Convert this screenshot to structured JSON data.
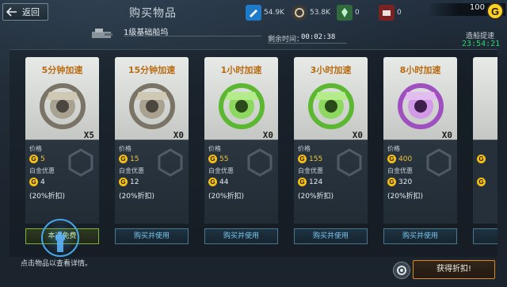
{
  "header": {
    "back_label": "返回",
    "title": "购买物品",
    "resources": [
      {
        "icon": "blueprint-icon",
        "value": "54.9K"
      },
      {
        "icon": "helmet-icon",
        "value": "53.8K"
      },
      {
        "icon": "crystal-icon",
        "value": "0"
      },
      {
        "icon": "cargo-icon",
        "value": "0"
      }
    ],
    "g_balance": "100",
    "g_logo": "G"
  },
  "info": {
    "dock_name": "1级基础船坞",
    "remaining_label": "剩余时间：",
    "remaining_time": "00:02:38",
    "accel_label": "造船提速",
    "accel_time": "23:54:21"
  },
  "cards": [
    {
      "name": "5分钟加速",
      "qty": "X5",
      "price_label": "价格",
      "price": "5",
      "vip_label": "白金优惠",
      "vip_price": "4",
      "discount": "(20%折扣)",
      "action": "本次免费",
      "tier": "silver"
    },
    {
      "name": "15分钟加速",
      "qty": "X0",
      "price_label": "价格",
      "price": "15",
      "vip_label": "白金优惠",
      "vip_price": "12",
      "discount": "(20%折扣)",
      "action": "购买并使用",
      "tier": "silver"
    },
    {
      "name": "1小时加速",
      "qty": "X0",
      "price_label": "价格",
      "price": "55",
      "vip_label": "白金优惠",
      "vip_price": "44",
      "discount": "(20%折扣)",
      "action": "购买并使用",
      "tier": "green"
    },
    {
      "name": "3小时加速",
      "qty": "X0",
      "price_label": "价格",
      "price": "155",
      "vip_label": "白金优惠",
      "vip_price": "124",
      "discount": "(20%折扣)",
      "action": "购买并使用",
      "tier": "green"
    },
    {
      "name": "8小时加速",
      "qty": "X0",
      "price_label": "价格",
      "price": "400",
      "vip_label": "白金优惠",
      "vip_price": "320",
      "discount": "(20%折扣)",
      "action": "购买并使用",
      "tier": "purple"
    }
  ],
  "footer": {
    "hint": "点击物品以查看详情。",
    "discount_button": "获得折扣!"
  },
  "colors": {
    "accent_orange": "#b86b10",
    "price_gold": "#e8c63a",
    "timer_green": "#29d36a",
    "button_blue": "#78c6f0",
    "tier_silver": "#c8c0a8",
    "tier_green": "#7ee04a",
    "tier_purple": "#c97ae0"
  }
}
